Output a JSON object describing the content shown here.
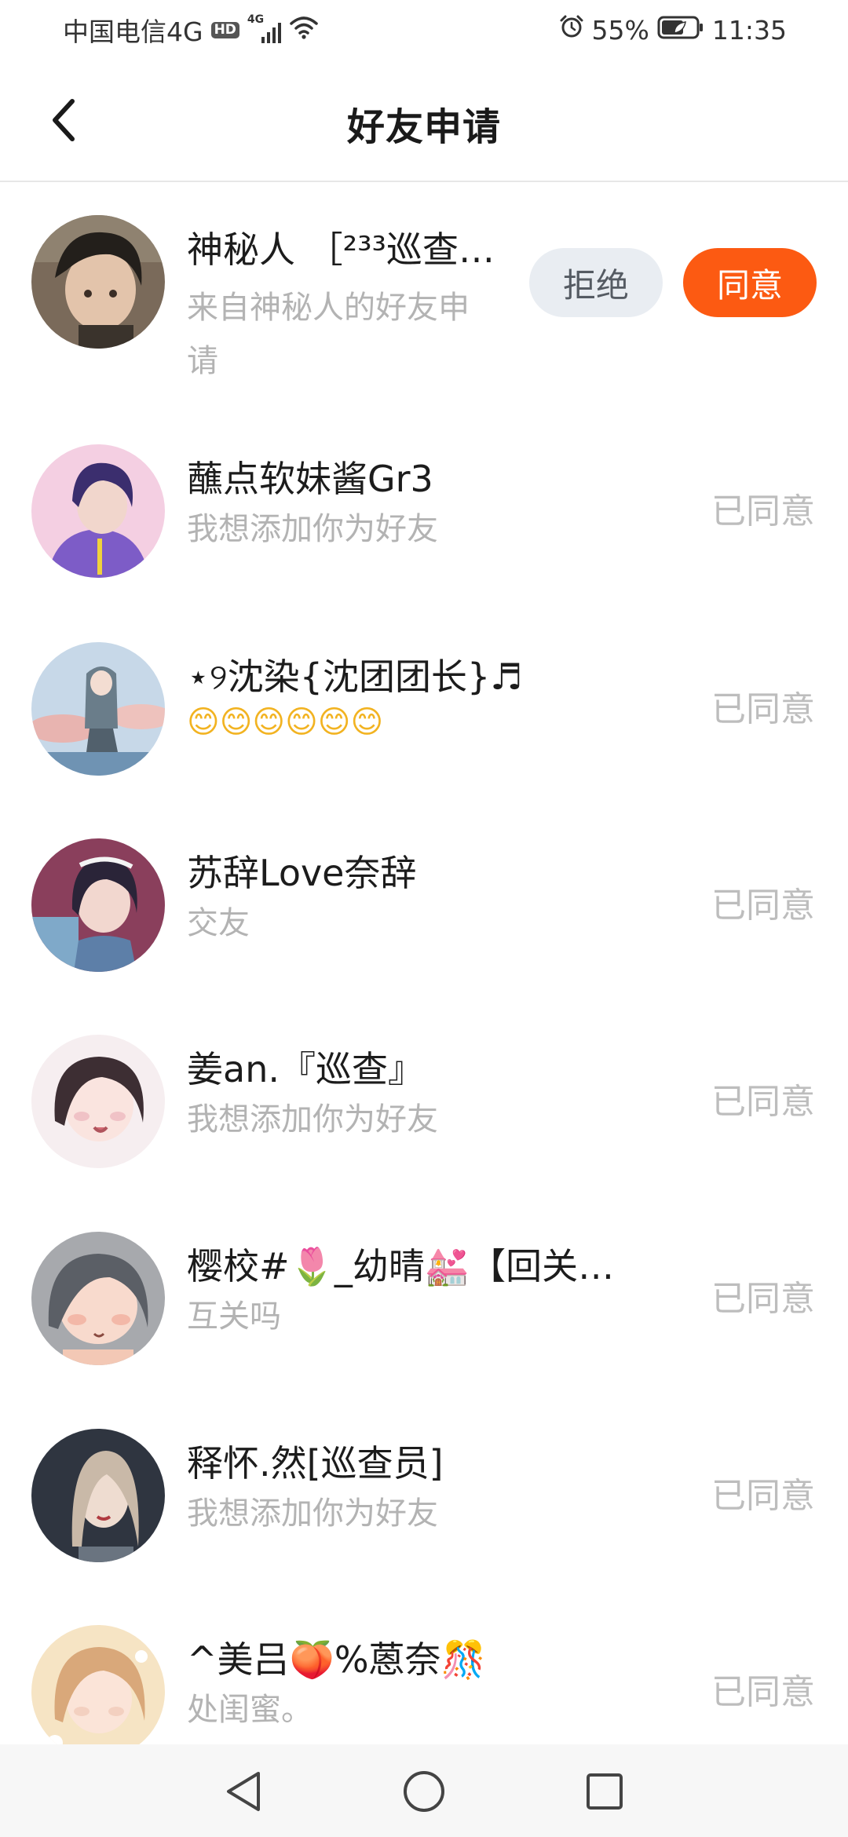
{
  "status_bar": {
    "carrier": "中国电信4G",
    "hd_badge": "HD",
    "network_type": "4G",
    "battery_percent": "55%",
    "time": "11:35",
    "icons": [
      "signal-icon",
      "wifi-icon",
      "alarm-icon",
      "battery-icon"
    ]
  },
  "header": {
    "title": "好友申请",
    "back_icon": "chevron-left-icon"
  },
  "requests": [
    {
      "name": "神秘人 ［²³³巡查…",
      "message": "来自神秘人的好友申请",
      "message_line1": "来自神秘人的好友申",
      "message_line2": "请",
      "status": "pending",
      "reject_label": "拒绝",
      "accept_label": "同意",
      "avatar_colors": [
        "#7a6a5a",
        "#2a2620",
        "#d9b9a0"
      ]
    },
    {
      "name": "蘸点软妹酱Gr3",
      "message": "我想添加你为好友",
      "status": "已同意",
      "avatar_colors": [
        "#f4cfe2",
        "#7d5cc7",
        "#3b2e6e"
      ]
    },
    {
      "name": "⋆୨沈染{沈团团长}♬",
      "message": "😊😊😊😊😊😊",
      "status": "已同意",
      "avatar_colors": [
        "#c7d8e8",
        "#e8b4b0",
        "#6a7d8a"
      ]
    },
    {
      "name": "苏辞Love奈辞",
      "message": "交友",
      "status": "已同意",
      "avatar_colors": [
        "#8a3f5c",
        "#2a2438",
        "#7fa9c9"
      ]
    },
    {
      "name": "姜an.『巡查』",
      "message": "我想添加你为好友",
      "status": "已同意",
      "avatar_colors": [
        "#f6eef0",
        "#3d2e33",
        "#f0c2c6"
      ]
    },
    {
      "name": "樱校#🌷_幼晴💒【回关…",
      "message": "互关吗",
      "status": "已同意",
      "avatar_colors": [
        "#a7a9ad",
        "#5b5f66",
        "#f3c8b5"
      ]
    },
    {
      "name": "释怀.然[巡查员]",
      "message": "我想添加你为好友",
      "status": "已同意",
      "avatar_colors": [
        "#2f3540",
        "#c9b9a8",
        "#6a7480"
      ]
    },
    {
      "name": "^美吕🍑%蒽奈🎊",
      "message": "处闺蜜。",
      "status": "已同意",
      "avatar_colors": [
        "#f6e4c4",
        "#d9a87a",
        "#f3d0c0"
      ]
    }
  ],
  "nav_bar": {
    "icons": [
      "back-triangle-icon",
      "home-circle-icon",
      "recents-square-icon"
    ]
  }
}
